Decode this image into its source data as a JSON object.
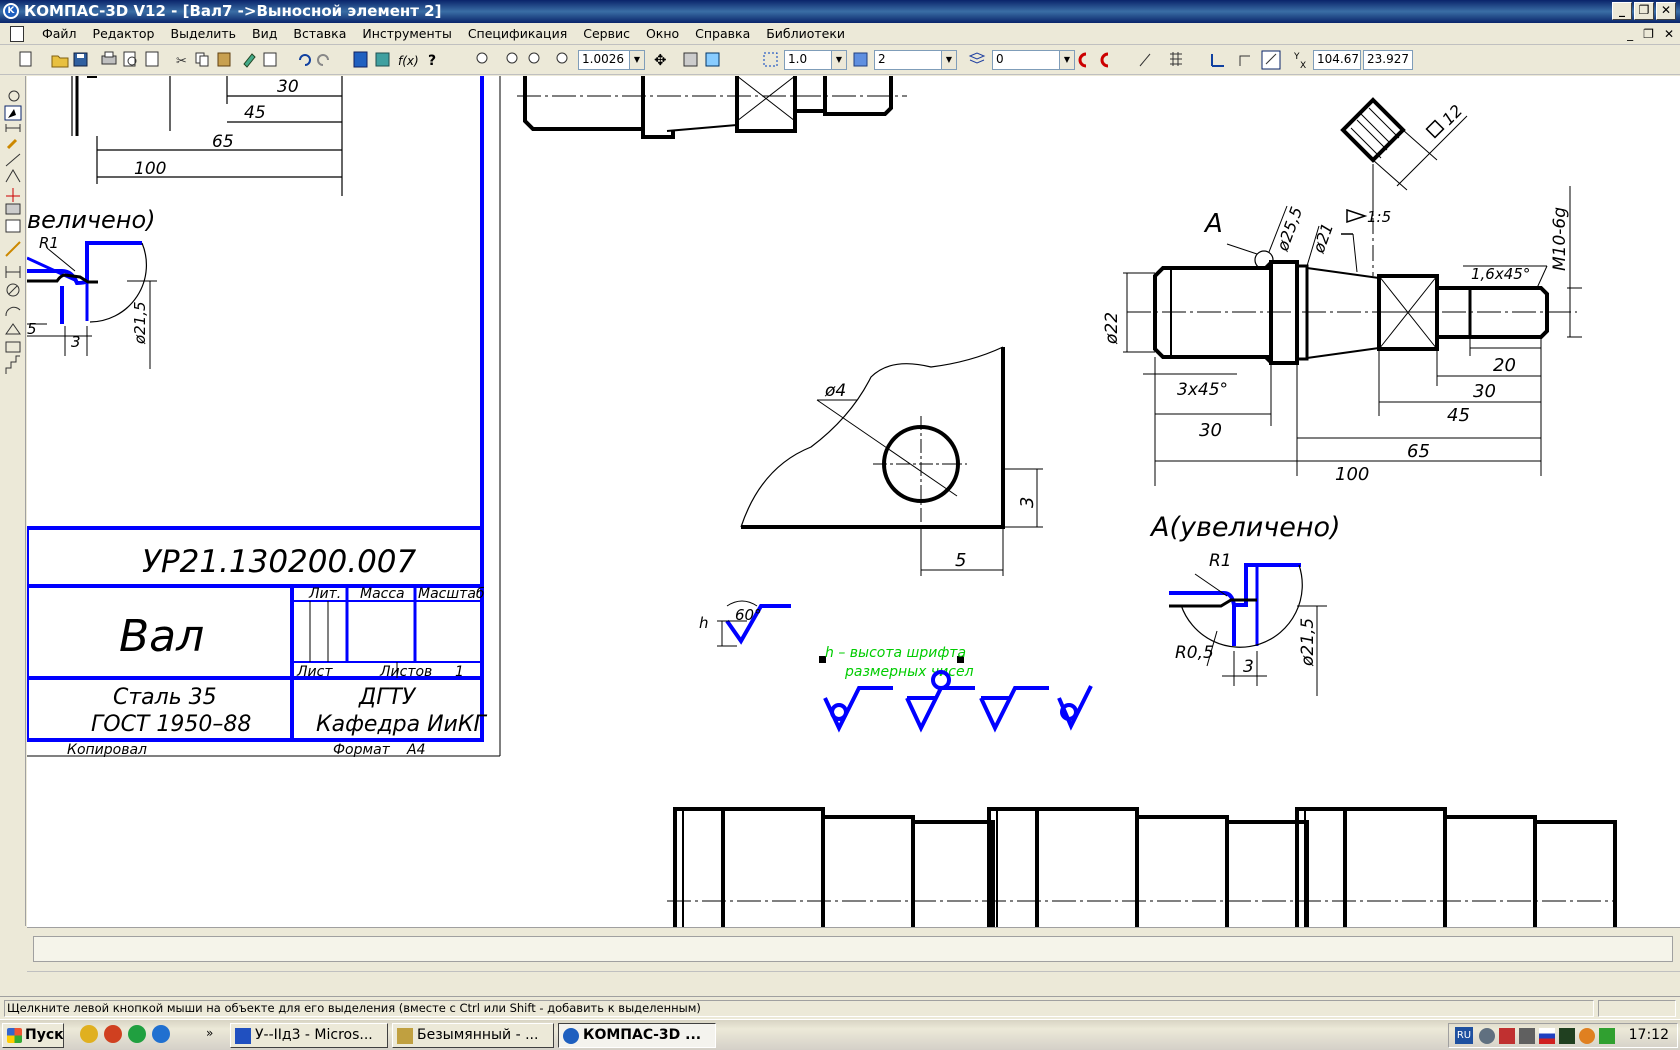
{
  "window": {
    "title": "КОМПАС-3D V12 - [Вал7 ->Выносной элемент 2]",
    "app_icon": "kompas-logo-icon"
  },
  "menu": {
    "items": [
      "Файл",
      "Редактор",
      "Выделить",
      "Вид",
      "Вставка",
      "Инструменты",
      "Спецификация",
      "Сервис",
      "Окно",
      "Справка",
      "Библиотеки"
    ]
  },
  "toolbar": {
    "zoom_value": "1.0026",
    "step_value": "1.0",
    "style_value": "2",
    "layer_value": "0",
    "coord_x": "104.67",
    "coord_y": "23.927",
    "coord_label": "Y X"
  },
  "drawing": {
    "top_dims": [
      "30",
      "45",
      "65",
      "100"
    ],
    "scaled_label": "A(увеличено)",
    "scaled_label_left": "величено)",
    "r1": "R1",
    "r05": "R0,5",
    "d215": "ø21,5",
    "dim3": "3",
    "dim5": "5",
    "stamp": {
      "designation": "УР21.130200.007",
      "name": "Вал",
      "lit_label": "Лит.",
      "mass_label": "Масса",
      "scale_label": "Масштаб",
      "sheet_label": "Лист",
      "sheets_label": "Листов",
      "sheets_value": "1",
      "material_line1": "Сталь 35",
      "material_line2": "ГОСТ 1950–88",
      "org_line1": "ДГТУ",
      "org_line2": "Кафедра ИиКГ",
      "copied_label": "Копировал",
      "format_label": "Формат",
      "format_value": "A4"
    },
    "shaft": {
      "label_a": "A",
      "d255": "ø25,5",
      "d21": "ø21",
      "taper": "1:5",
      "chamfer_r": "1,6x45°",
      "thread": "M10-6g",
      "d22": "ø22",
      "chamfer_l": "3x45°",
      "dim20": "20",
      "dim30r": "30",
      "dim45": "45",
      "dim65": "65",
      "dim100": "100",
      "dim30l": "30",
      "square": "12"
    },
    "hole": {
      "d4": "ø4",
      "dim3": "3",
      "dim5": "5"
    },
    "roughness": {
      "h": "h",
      "angle": "60°",
      "note_line1": "h – высота шрифта",
      "note_line2": "размерных чисел"
    }
  },
  "status": {
    "message": "Щелкните левой кнопкой мыши на объекте для его выделения (вместе с Ctrl или Shift - добавить к выделенным)"
  },
  "taskbar": {
    "start": "Пуск",
    "tasks": [
      "У--IIд3 - Micros...",
      "Безымянный - ...",
      "КОМПАС-3D ..."
    ],
    "lang": "RU",
    "clock": "17:12"
  },
  "colors": {
    "accent_blue": "#0000ff",
    "note_green": "#00cc00",
    "titlebar": "#0a246a"
  }
}
